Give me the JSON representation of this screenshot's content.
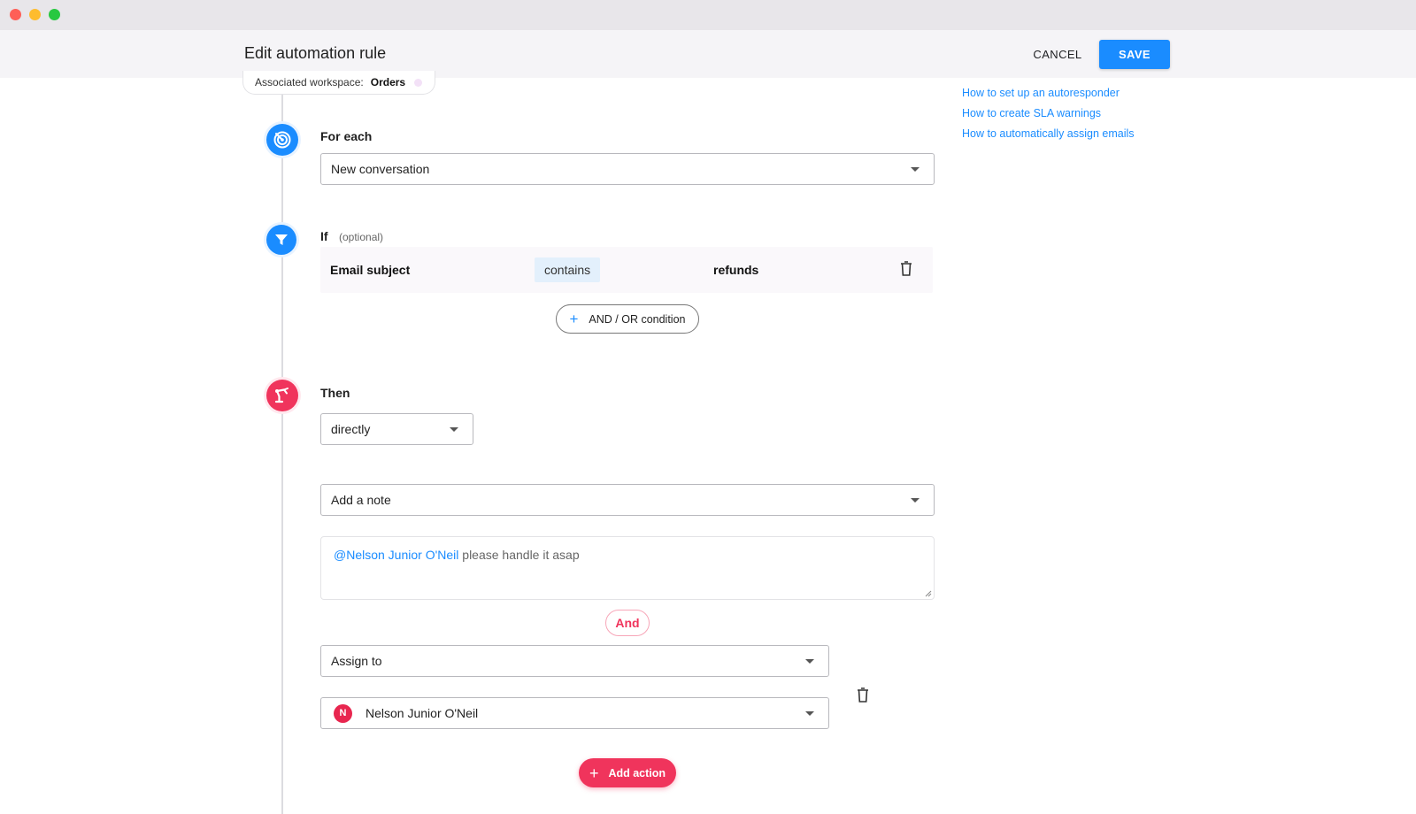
{
  "header": {
    "title": "Edit automation rule",
    "cancel_label": "CANCEL",
    "save_label": "SAVE"
  },
  "workspace": {
    "label": "Associated workspace:",
    "value": "Orders"
  },
  "help_links": [
    "How to set up an autoresponder",
    "How to create SLA warnings",
    "How to automatically assign emails"
  ],
  "trigger": {
    "label": "For each",
    "selected": "New conversation"
  },
  "condition": {
    "label": "If",
    "optional_label": "(optional)",
    "field": "Email subject",
    "operator": "contains",
    "value": "refunds",
    "add_condition_label": "AND / OR condition"
  },
  "actions": {
    "label": "Then",
    "timing": "directly",
    "first_action": "Add a note",
    "note": {
      "mention": "@Nelson Junior O'Neil",
      "text": " please handle it asap"
    },
    "and_label": "And",
    "second_action": "Assign to",
    "assignee": {
      "initial": "N",
      "name": "Nelson Junior O'Neil"
    },
    "add_action_label": "Add action"
  },
  "colors": {
    "primary": "#1a8cff",
    "accent": "#f0345c"
  }
}
